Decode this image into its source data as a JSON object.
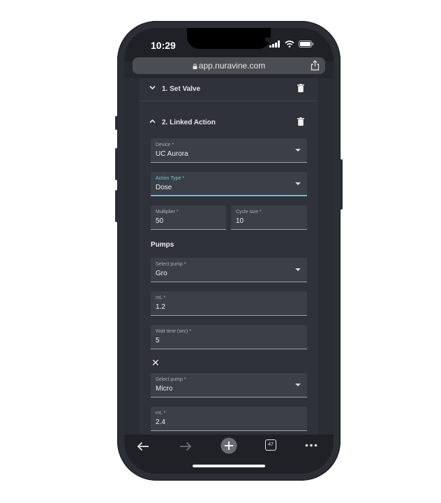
{
  "status_bar": {
    "time": "10:29"
  },
  "browser": {
    "url": "app.nuravine.com",
    "tab_count": "47"
  },
  "sections": [
    {
      "label": "1. Set Valve",
      "expanded": false
    },
    {
      "label": "2. Linked Action",
      "expanded": true
    }
  ],
  "fields": {
    "device": {
      "label": "Device *",
      "value": "UC Aurora"
    },
    "action_type": {
      "label": "Action Type *",
      "value": "Dose"
    },
    "multiplier": {
      "label": "Multiplier *",
      "value": "50"
    },
    "cycle_size": {
      "label": "Cycle size *",
      "value": "10"
    }
  },
  "pumps": {
    "title": "Pumps",
    "pump1": {
      "select": {
        "label": "Select pump *",
        "value": "Gro"
      },
      "ml": {
        "label": "mL *",
        "value": "1.2"
      },
      "wait": {
        "label": "Wait time (sec) *",
        "value": "5"
      }
    },
    "remove_symbol": "✕",
    "pump2": {
      "select": {
        "label": "Select pump *",
        "value": "Micro"
      },
      "ml": {
        "label": "mL *",
        "value": "2.4"
      }
    }
  },
  "icons": [
    "chevron-down-icon",
    "chevron-up-icon",
    "trash-icon",
    "lock-icon",
    "share-icon",
    "back-arrow-icon",
    "forward-arrow-icon",
    "new-tab-plus-icon",
    "tabs-icon",
    "more-icon",
    "signal-icon",
    "wifi-icon",
    "battery-icon"
  ],
  "colors": {
    "background": "#2a2d33",
    "panel": "#2f323a",
    "field": "#3b3f47",
    "accent": "#5fc3d2"
  }
}
